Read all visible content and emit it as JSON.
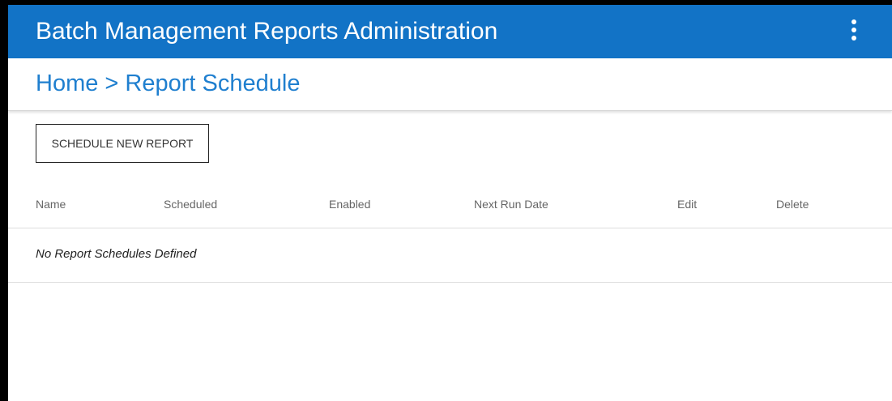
{
  "app": {
    "title": "Batch Management Reports Administration",
    "menu_icon": "more-vertical-icon",
    "accent_color": "#1273c6"
  },
  "breadcrumb": {
    "home": "Home",
    "separator": ">",
    "current": "Report Schedule",
    "color": "#1f7fcf"
  },
  "toolbar": {
    "schedule_new_label": "SCHEDULE NEW REPORT"
  },
  "table": {
    "columns": [
      "Name",
      "Scheduled",
      "Enabled",
      "Next Run Date",
      "Edit",
      "Delete"
    ],
    "empty_message": "No Report Schedules Defined"
  }
}
